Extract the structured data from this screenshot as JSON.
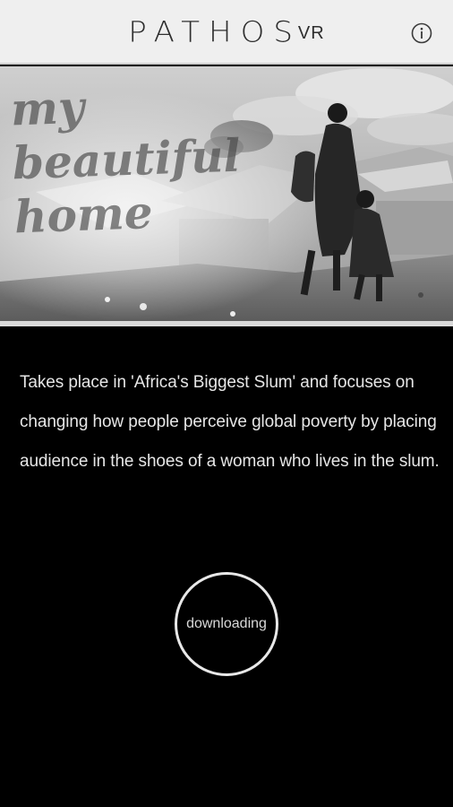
{
  "header": {
    "logo_main": "PATHOS",
    "logo_sub": "VR",
    "info_icon": "info-circle-icon"
  },
  "hero": {
    "title": "my\nbeautiful\nhome"
  },
  "description": {
    "text": "Takes place in 'Africa's Biggest Slum' and focuses on changing how people perceive global poverty by placing audience in the shoes of a woman who lives in the slum."
  },
  "status": {
    "label": "downloading"
  },
  "colors": {
    "header_bg": "#efefef",
    "page_bg": "#000000",
    "text": "#e6e6e6",
    "ring": "#e8e8e8"
  }
}
